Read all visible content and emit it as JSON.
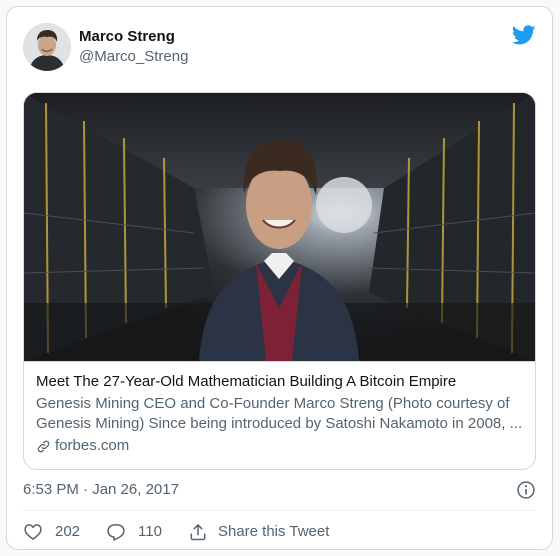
{
  "author": {
    "display_name": "Marco Streng",
    "handle": "@Marco_Streng"
  },
  "card": {
    "title": "Meet The 27-Year-Old Mathematician Building A Bitcoin Empire",
    "description": "Genesis Mining CEO and Co-Founder Marco Streng (Photo courtesy of Genesis Mining) Since being introduced by Satoshi Nakamoto in 2008, ...",
    "domain": "forbes.com"
  },
  "meta": {
    "timestamp": "6:53 PM · Jan 26, 2017"
  },
  "actions": {
    "like_count": "202",
    "reply_count": "110",
    "share_label": "Share this Tweet"
  },
  "icons": {
    "brand": "twitter-bird-icon",
    "info": "info-icon",
    "link": "link-icon",
    "like": "heart-icon",
    "reply": "reply-icon",
    "share": "share-icon"
  },
  "colors": {
    "twitter_blue": "#1d9bf0",
    "text_primary": "#0f1419",
    "text_secondary": "#536471",
    "border": "#cfd9de"
  }
}
